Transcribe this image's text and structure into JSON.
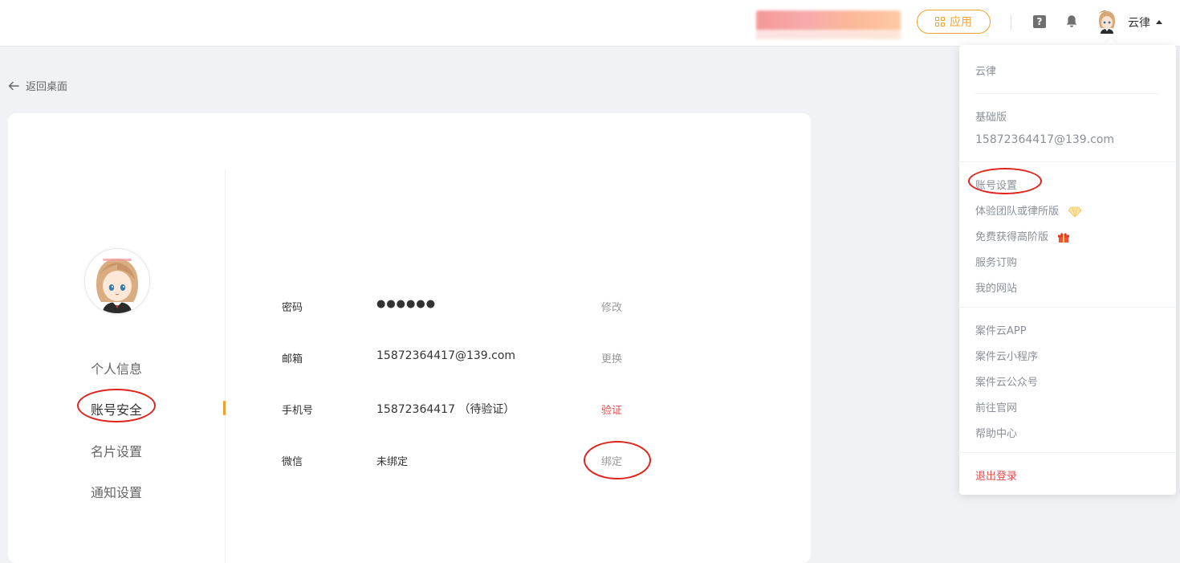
{
  "header": {
    "apps_label": "应用",
    "user_name": "云律",
    "help_glyph": "?"
  },
  "nav": {
    "back_label": "返回桌面",
    "items": [
      {
        "label": "个人信息"
      },
      {
        "label": "账号安全",
        "active": true
      },
      {
        "label": "名片设置"
      },
      {
        "label": "通知设置"
      }
    ]
  },
  "account": {
    "rows": [
      {
        "label": "密码",
        "value": "●●●●●●",
        "action": "修改"
      },
      {
        "label": "邮箱",
        "value": "15872364417@139.com",
        "action": "更换"
      },
      {
        "label": "手机号",
        "value": "15872364417 （待验证）",
        "action": "验证"
      },
      {
        "label": "微信",
        "value": "未绑定",
        "action": "绑定"
      }
    ]
  },
  "dropdown": {
    "username": "云律",
    "plan": "基础版",
    "email": "15872364417@139.com",
    "account_settings": "账号设置",
    "trial_team": "体验团队或律所版",
    "free_upgrade": "免费获得高阶版",
    "subscription": "服务订购",
    "my_site": "我的网站",
    "app": "案件云APP",
    "mini_program": "案件云小程序",
    "official_account": "案件云公众号",
    "website": "前往官网",
    "help_center": "帮助中心",
    "logout": "退出登录"
  },
  "colors": {
    "accent": "#f0a132",
    "danger": "#e34d4d",
    "annotation": "#e0231c",
    "page_bg": "#f0f2f5"
  },
  "icons": {
    "back": "arrow-left-icon",
    "apps": "grid-icon",
    "help": "question-icon",
    "notifications": "bell-icon",
    "caret": "caret-up-icon",
    "diamond": "diamond-icon",
    "gift": "gift-icon"
  }
}
